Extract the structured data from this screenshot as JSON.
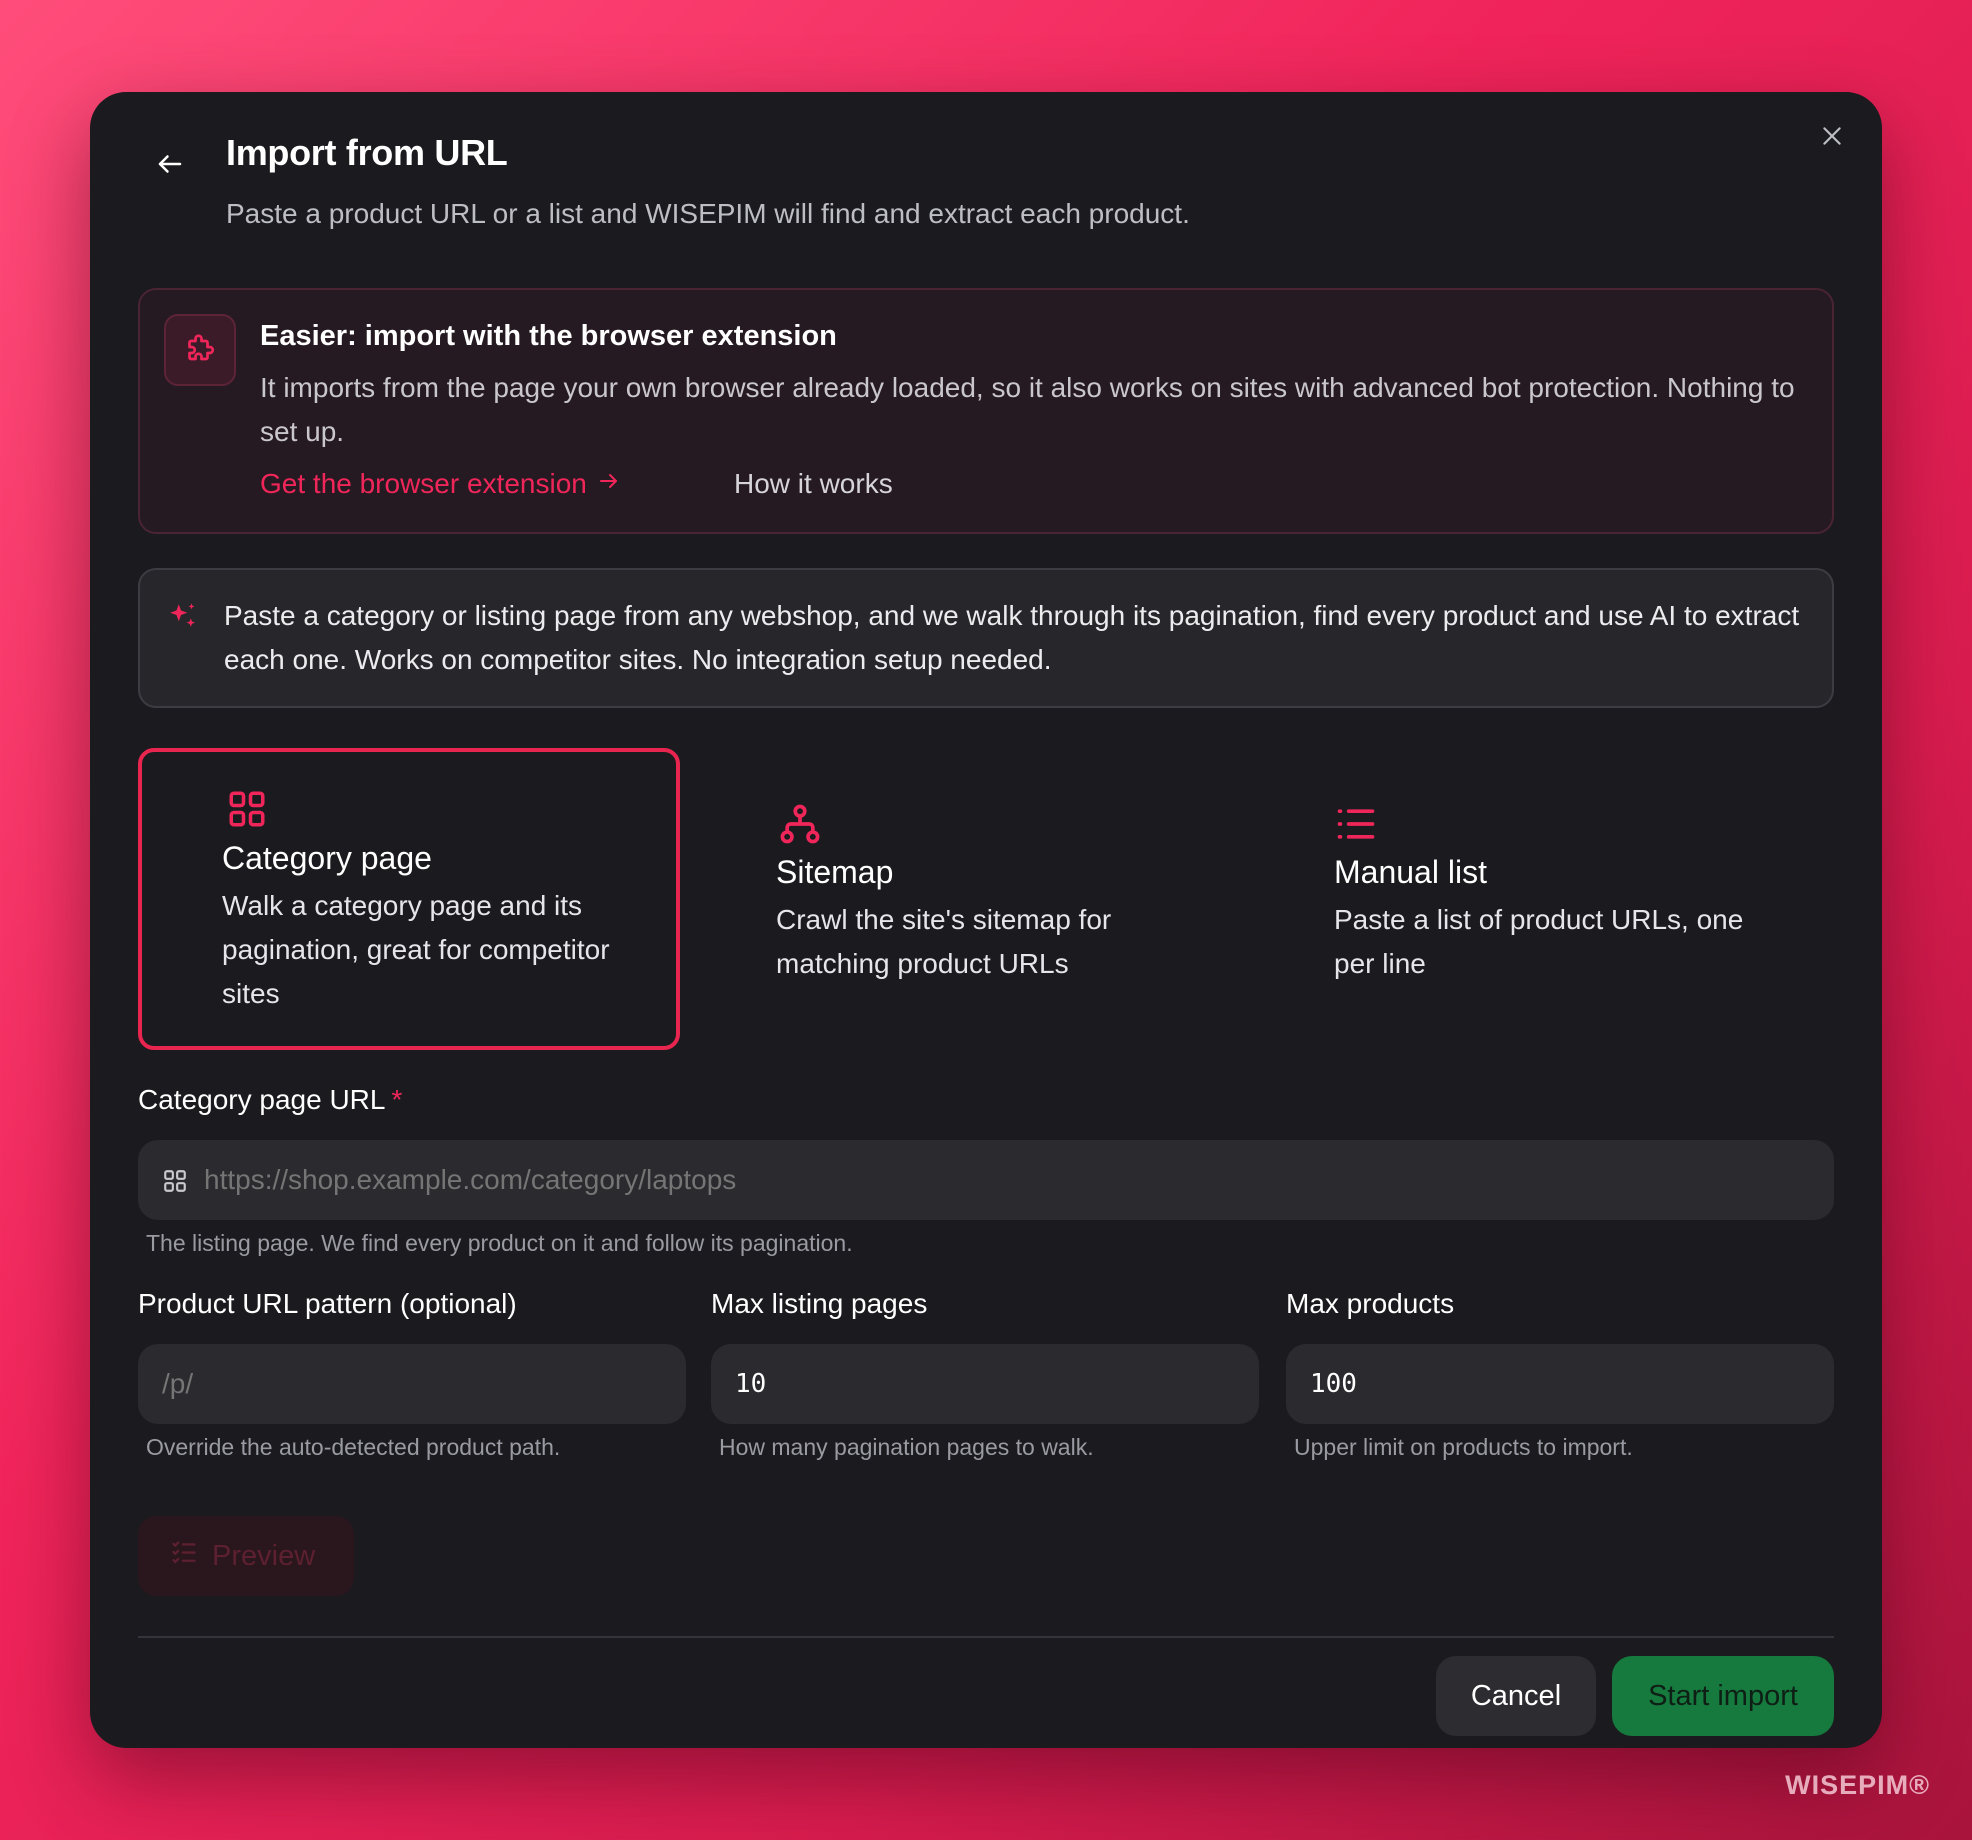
{
  "dialog": {
    "title": "Import from URL",
    "subtitle": "Paste a product URL or a list and WISEPIM will find and extract each product."
  },
  "extension_card": {
    "title": "Easier: import with the browser extension",
    "body": "It imports from the page your own browser already loaded, so it also works on sites with advanced bot protection. Nothing to set up.",
    "link_label": "Get the browser extension",
    "how_label": "How it works"
  },
  "info": {
    "text": "Paste a category or listing page from any webshop, and we walk through its pagination, find every product and use AI to extract each one. Works on competitor sites. No integration setup needed."
  },
  "modes": [
    {
      "title": "Category page",
      "desc": "Walk a category page and its pagination, great for competitor sites",
      "icon": "grid-icon",
      "selected": true
    },
    {
      "title": "Sitemap",
      "desc": "Crawl the site's sitemap for matching product URLs",
      "icon": "sitemap-icon",
      "selected": false
    },
    {
      "title": "Manual list",
      "desc": "Paste a list of product URLs, one per line",
      "icon": "list-icon",
      "selected": false
    }
  ],
  "form": {
    "url": {
      "label": "Category page URL",
      "required_mark": "*",
      "placeholder": "https://shop.example.com/category/laptops",
      "help": "The listing page. We find every product on it and follow its pagination."
    },
    "pattern": {
      "label": "Product URL pattern (optional)",
      "placeholder": "/p/",
      "help": "Override the auto-detected product path."
    },
    "max_pages": {
      "label": "Max listing pages",
      "value": "10",
      "help": "How many pagination pages to walk."
    },
    "max_products": {
      "label": "Max products",
      "value": "100",
      "help": "Upper limit on products to import."
    }
  },
  "actions": {
    "preview": "Preview",
    "cancel": "Cancel",
    "start": "Start import"
  },
  "watermark": "WISEPIM®",
  "colors": {
    "accent": "#e8254f",
    "primary_button": "#16793d",
    "modal_bg": "#1b1b1f"
  }
}
